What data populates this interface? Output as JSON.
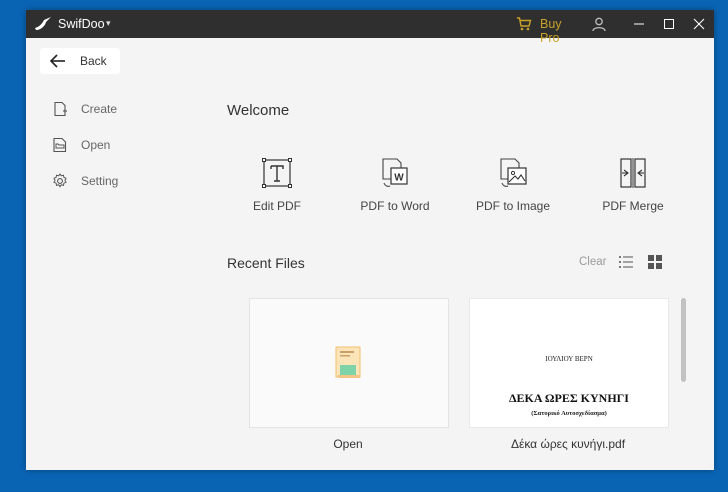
{
  "titlebar": {
    "app_name": "SwifDoo",
    "buy_pro": "Buy Pro",
    "icons": {
      "logo": "swifdoo-bird-logo",
      "menu": "chevron-down-icon",
      "cart": "shopping-cart-icon",
      "user": "user-icon",
      "minimize": "minimize-icon",
      "maximize": "maximize-icon",
      "close": "close-icon"
    }
  },
  "sidebar": {
    "back_label": "Back",
    "items": [
      {
        "label": "Create",
        "icon": "create-file-icon"
      },
      {
        "label": "Open",
        "icon": "open-file-icon"
      },
      {
        "label": "Setting",
        "icon": "gear-icon"
      }
    ]
  },
  "main": {
    "welcome": "Welcome",
    "tools": [
      {
        "label": "Edit PDF",
        "icon": "edit-text-icon"
      },
      {
        "label": "PDF to Word",
        "icon": "pdf-to-word-icon"
      },
      {
        "label": "PDF to Image",
        "icon": "pdf-to-image-icon"
      },
      {
        "label": "PDF Merge",
        "icon": "pdf-merge-icon"
      }
    ],
    "recent": {
      "title": "Recent Files",
      "clear": "Clear",
      "files": [
        {
          "name": "Open",
          "type": "open"
        },
        {
          "name": "Δέκα ώρες κυνήγι.pdf",
          "type": "pdf",
          "preview": {
            "author": "ΙΟΥΛΙΟΥ ΒΕΡΝ",
            "title": "ΔΕΚΑ ΩΡΕΣ ΚΥΝΗΓΙ",
            "subtitle": "(Σατυρικό Αυτοσχεδίασμα)"
          }
        }
      ]
    }
  },
  "colors": {
    "desktop": "#0a64b4",
    "titlebar": "#2f2f2f",
    "window_bg": "#f4f4f4",
    "buy_pro": "#c9a227"
  }
}
